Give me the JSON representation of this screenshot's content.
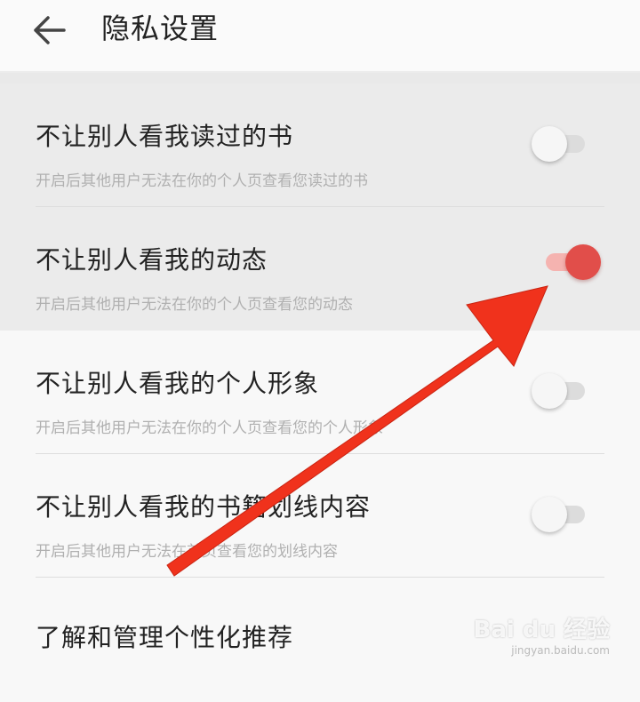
{
  "header": {
    "title": "隐私设置"
  },
  "settings": [
    {
      "title": "不让别人看我读过的书",
      "subtitle": "开启后其他用户无法在你的个人页查看您读过的书",
      "enabled": false
    },
    {
      "title": "不让别人看我的动态",
      "subtitle": "开启后其他用户无法在你的个人页查看您的动态",
      "enabled": true
    },
    {
      "title": "不让别人看我的个人形象",
      "subtitle": "开启后其他用户无法在你的个人页查看您的个人形象",
      "enabled": false
    },
    {
      "title": "不让别人看我的书籍划线内容",
      "subtitle": "开启后其他用户无法在首页查看您的划线内容",
      "enabled": false
    }
  ],
  "recommend": {
    "title": "了解和管理个性化推荐"
  },
  "watermark": {
    "main": "Bai du 经验",
    "url": "jingyan.baidu.com"
  },
  "colors": {
    "accent": "#e14e4a",
    "arrow": "#f0321c"
  }
}
